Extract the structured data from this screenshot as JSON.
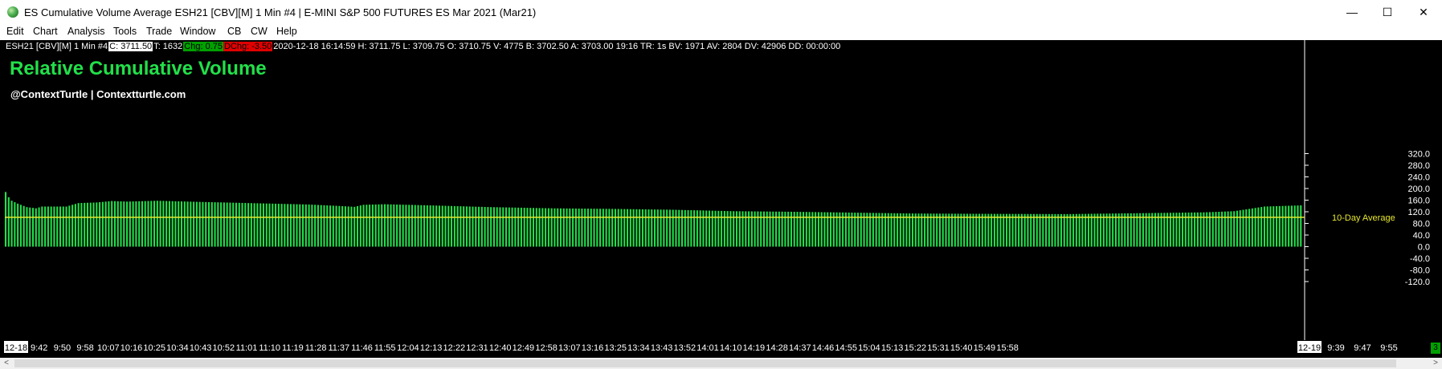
{
  "window": {
    "title": "ES Cumulative Volume Average ESH21 [CBV][M]  1 Min   #4 | E-MINI S&P 500 FUTURES ES Mar 2021 (Mar21)",
    "minimize": "—",
    "maximize": "☐",
    "close": "✕"
  },
  "menu": [
    "Edit",
    "Chart",
    "Analysis",
    "Tools",
    "Trade",
    "Window",
    "CB",
    "CW",
    "Help"
  ],
  "infobar": {
    "symbol": "ESH21 [CBV][M]  1 Min   #4",
    "close": "C: 3711.50",
    "ticks": "T: 1632",
    "chg": "Chg: 0.75",
    "dchg": "DChg: -3.50",
    "rest": "2020-12-18 16:14:59 H: 3711.75 L: 3709.75 O: 3710.75 V: 4775 B: 3702.50 A: 3703.00 19:16 TR: 1s BV: 1971 AV: 2804 DV: 42906 DD: 00:00:00"
  },
  "chart_title": "Relative Cumulative Volume",
  "chart_subtitle": "@ContextTurtle | Contextturtle.com",
  "corner_badge": "3",
  "chart_data": {
    "type": "bar",
    "title": "Relative Cumulative Volume",
    "y_ticks": [
      "320.0",
      "280.0",
      "240.0",
      "200.0",
      "160.0",
      "120.0",
      "80.0",
      "40.0",
      "0.0",
      "-40.0",
      "-80.0",
      "-120.0"
    ],
    "ylim": [
      -140,
      350
    ],
    "x_ticks": [
      "12-18",
      "9:42",
      "9:50",
      "9:58",
      "10:07",
      "10:16",
      "10:25",
      "10:34",
      "10:43",
      "10:52",
      "11:01",
      "11:10",
      "11:19",
      "11:28",
      "11:37",
      "11:46",
      "11:55",
      "12:04",
      "12:13",
      "12:22",
      "12:31",
      "12:40",
      "12:49",
      "12:58",
      "13:07",
      "13:16",
      "13:25",
      "13:34",
      "13:43",
      "13:52",
      "14:01",
      "14:10",
      "14:19",
      "14:28",
      "14:37",
      "14:46",
      "14:55",
      "15:04",
      "15:13",
      "15:22",
      "15:31",
      "15:40",
      "15:49",
      "15:58",
      "12-19",
      "9:39",
      "9:47",
      "9:55"
    ],
    "reference_line": {
      "value": 101,
      "label": "10-Day Average"
    },
    "bar_color": "#22e04a",
    "line_color": "#e8e830",
    "keypoints": [
      [
        0,
        188
      ],
      [
        1,
        170
      ],
      [
        2,
        158
      ],
      [
        4,
        148
      ],
      [
        7,
        136
      ],
      [
        10,
        132
      ],
      [
        12,
        138
      ],
      [
        20,
        138
      ],
      [
        24,
        150
      ],
      [
        30,
        152
      ],
      [
        35,
        157
      ],
      [
        40,
        155
      ],
      [
        50,
        158
      ],
      [
        60,
        155
      ],
      [
        80,
        150
      ],
      [
        100,
        145
      ],
      [
        110,
        140
      ],
      [
        115,
        137
      ],
      [
        118,
        144
      ],
      [
        125,
        146
      ],
      [
        140,
        142
      ],
      [
        160,
        136
      ],
      [
        180,
        132
      ],
      [
        200,
        130
      ],
      [
        220,
        127
      ],
      [
        240,
        122
      ],
      [
        260,
        120
      ],
      [
        280,
        117
      ],
      [
        300,
        114
      ],
      [
        320,
        113
      ],
      [
        350,
        112
      ],
      [
        380,
        116
      ],
      [
        395,
        118
      ],
      [
        405,
        122
      ],
      [
        410,
        130
      ],
      [
        415,
        138
      ],
      [
        421,
        140
      ],
      [
        427,
        142
      ]
    ],
    "bar_count": 428
  }
}
